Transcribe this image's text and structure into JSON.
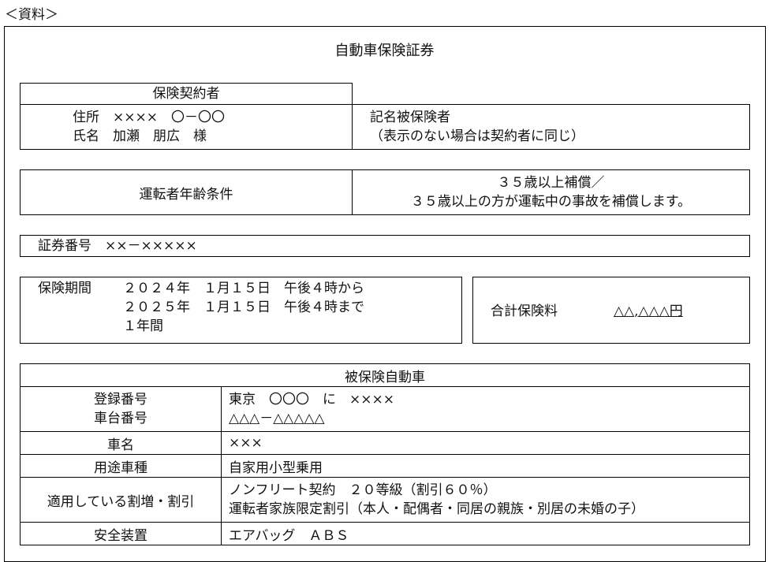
{
  "caption": "＜資料＞",
  "title": "自動車保険証券",
  "policyholder": {
    "header": "保険契約者",
    "address_line": "住所　××××　〇－〇〇",
    "name_line": "氏名　加瀬　朋広　様"
  },
  "named_insured": {
    "label": "記名被保険者",
    "note": "（表示のない場合は契約者に同じ）"
  },
  "driver_age": {
    "label": "運転者年齢条件",
    "value_line1": "３５歳以上補償／",
    "value_line2": "３５歳以上の方が運転中の事故を補償します。"
  },
  "certificate": {
    "line": "証券番号　××－×××××"
  },
  "period": {
    "label": "保険期間",
    "from": "２０２４年　１月１５日　午後４時から",
    "to": "２０２５年　１月１５日　午後４時まで",
    "duration": "１年間"
  },
  "premium": {
    "label": "合計保険料",
    "amount": "△△,△△△円"
  },
  "vehicle": {
    "header": "被保険自動車",
    "reg_label": "登録番号",
    "chassis_label": "車台番号",
    "reg_value": "東京　〇〇〇　に　××××",
    "chassis_value": "△△△－△△△△△",
    "name_label": "車名",
    "name_value": "×××",
    "usage_label": "用途車種",
    "usage_value": "自家用小型乗用",
    "discount_label": "適用している割増・割引",
    "discount_line1": "ノンフリート契約　２０等級（割引６０％）",
    "discount_line2": "運転者家族限定割引（本人・配偶者・同居の親族・別居の未婚の子）",
    "safety_label": "安全装置",
    "safety_value": "エアバッグ　ＡＢＳ"
  }
}
